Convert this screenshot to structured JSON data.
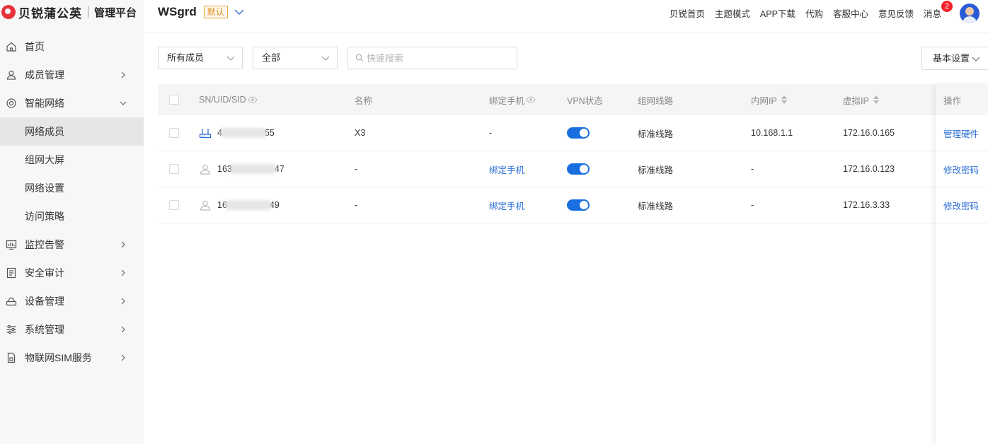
{
  "brand": {
    "name": "贝锐蒲公英",
    "subtitle": "管理平台",
    "logo_color": "#e8323c"
  },
  "sidebar": {
    "items": [
      {
        "label": "首页",
        "icon": "home-icon",
        "has_children": false
      },
      {
        "label": "成员管理",
        "icon": "user-icon",
        "has_children": true,
        "expanded": false
      },
      {
        "label": "智能网络",
        "icon": "network-icon",
        "has_children": true,
        "expanded": true,
        "children": [
          {
            "label": "网络成员",
            "active": true
          },
          {
            "label": "组网大屏",
            "active": false
          },
          {
            "label": "网络设置",
            "active": false
          },
          {
            "label": "访问策略",
            "active": false
          }
        ]
      },
      {
        "label": "监控告警",
        "icon": "monitor-icon",
        "has_children": true,
        "expanded": false
      },
      {
        "label": "安全审计",
        "icon": "audit-icon",
        "has_children": true,
        "expanded": false
      },
      {
        "label": "设备管理",
        "icon": "router-icon",
        "has_children": true,
        "expanded": false
      },
      {
        "label": "系统管理",
        "icon": "sliders-icon",
        "has_children": true,
        "expanded": false
      },
      {
        "label": "物联网SIM服务",
        "icon": "sim-icon",
        "has_children": true,
        "expanded": false
      }
    ]
  },
  "header": {
    "project_name": "WSgrd",
    "project_badge": "默认",
    "nav": [
      "贝锐首页",
      "主题模式",
      "APP下载",
      "代购",
      "客服中心",
      "意见反馈"
    ],
    "messages_label": "消息",
    "messages_count": "2"
  },
  "filters": {
    "member_type": "所有成员",
    "status": "全部",
    "search_placeholder": "快速搜索",
    "settings_label": "基本设置"
  },
  "table": {
    "columns": [
      "SN/UID/SID",
      "名称",
      "绑定手机",
      "VPN状态",
      "组网线路",
      "内网IP",
      "虚拟IP",
      "操作"
    ],
    "rows": [
      {
        "type": "router",
        "id_prefix": "4",
        "id_suffix": "55",
        "name": "X3",
        "phone": "-",
        "phone_is_link": false,
        "vpn": true,
        "route": "标准线路",
        "lan_ip": "10.168.1.1",
        "virtual_ip": "172.16.0.165",
        "action": "管理硬件"
      },
      {
        "type": "user",
        "id_prefix": "163",
        "id_suffix": "47",
        "name": "-",
        "phone": "绑定手机",
        "phone_is_link": true,
        "vpn": true,
        "route": "标准线路",
        "lan_ip": "-",
        "virtual_ip": "172.16.0.123",
        "action": "修改密码"
      },
      {
        "type": "user",
        "id_prefix": "16",
        "id_suffix": "49",
        "name": "-",
        "phone": "绑定手机",
        "phone_is_link": true,
        "vpn": true,
        "route": "标准线路",
        "lan_ip": "-",
        "virtual_ip": "172.16.3.33",
        "action": "修改密码"
      }
    ]
  },
  "colors": {
    "accent": "#1a6fe0",
    "link": "#2d6fd6",
    "badge": "#f5222d",
    "default_tag": "#e08a1e"
  }
}
